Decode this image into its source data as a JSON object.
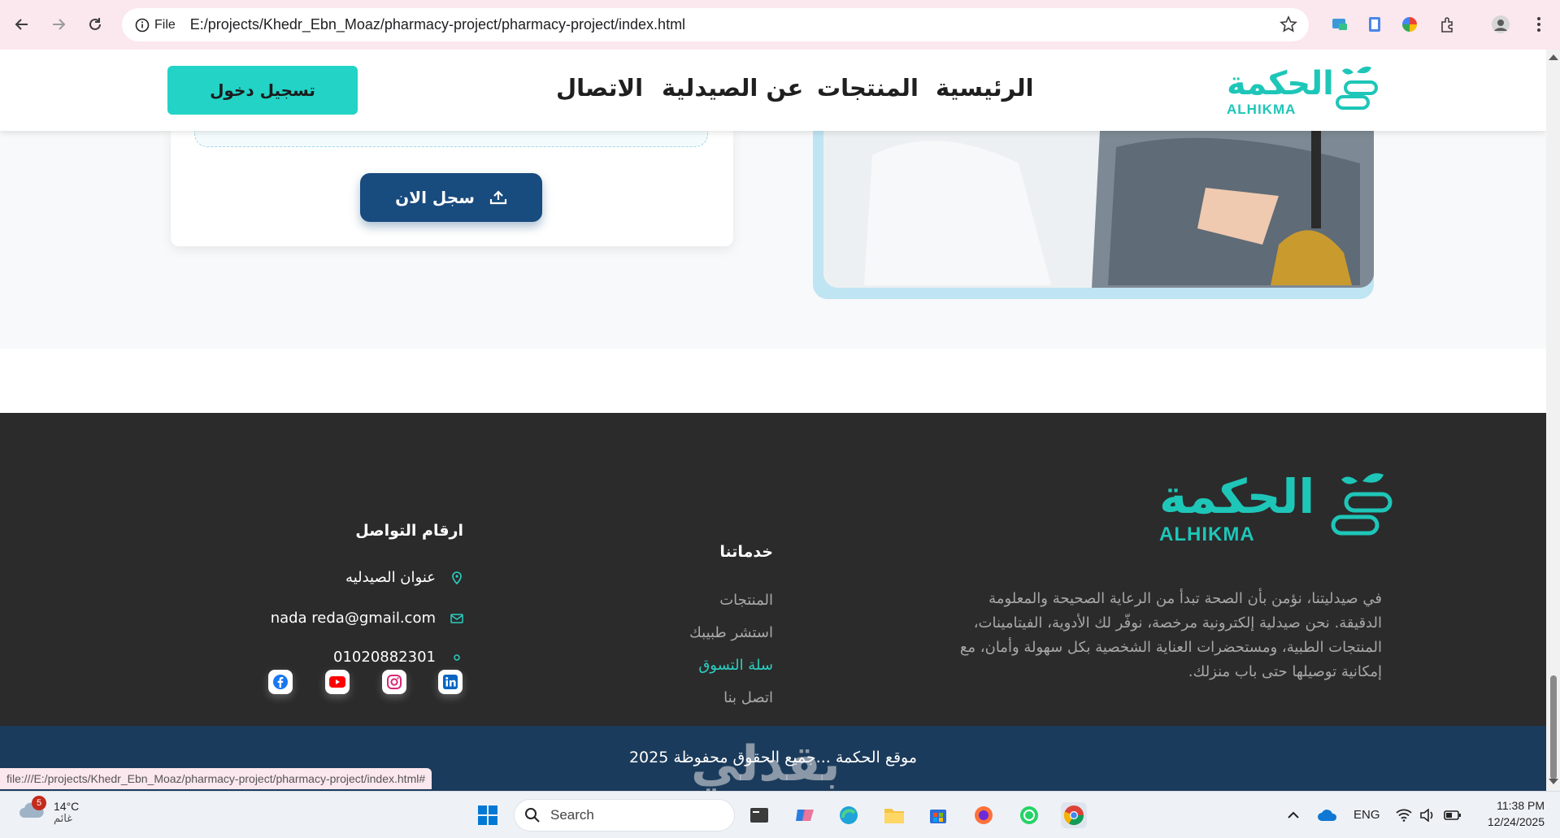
{
  "browser": {
    "file_chip": "File",
    "url": "E:/projects/Khedr_Ebn_Moaz/pharmacy-project/pharmacy-project/index.html",
    "status_url": "file:///E:/projects/Khedr_Ebn_Moaz/pharmacy-project/pharmacy-project/index.html#"
  },
  "header": {
    "logo_ar": "الحكمة",
    "logo_en": "ALHIKMA",
    "nav": [
      "الرئيسية",
      "المنتجات",
      "عن الصيدلية",
      "الاتصال"
    ],
    "login_label": "تسجيل دخول"
  },
  "form": {
    "register_label": "سجل الان"
  },
  "footer": {
    "logo_ar": "الحكمة",
    "logo_en": "ALHIKMA",
    "about_text": "في صيدليتنا، نؤمن بأن الصحة تبدأ من الرعاية الصحيحة والمعلومة الدقيقة. نحن صيدلية إلكترونية مرخصة، نوفّر لك الأدوية، الفيتامينات، المنتجات الطبية، ومستحضرات العناية الشخصية بكل سهولة وأمان، مع إمكانية توصيلها حتى باب منزلك.",
    "services_title": "خدماتنا",
    "services": [
      "المنتجات",
      "استشر طبيبك",
      "سلة التسوق",
      "اتصل بنا"
    ],
    "contact_title": "ارقام التواصل",
    "contact_address": "عنوان الصيدليه",
    "contact_email": "nada reda@gmail.com",
    "contact_phone": "01020882301",
    "social": [
      "linkedin-icon",
      "instagram-icon",
      "youtube-icon",
      "facebook-icon"
    ],
    "copyright": "موقع الحكمة ...جميع الحقوق محفوظة 2025",
    "watermark": "بقدلي"
  },
  "taskbar": {
    "weather_temp": "14°C",
    "weather_desc": "غائم",
    "weather_badge": "5",
    "search_label": "Search",
    "lang": "ENG",
    "time": "11:38 PM",
    "date": "12/24/2025"
  },
  "colors": {
    "accent": "#22d3c6",
    "primary": "#184b7e",
    "footer_bg": "#2b2b2b",
    "copyright_bg": "#1b3b5c"
  }
}
